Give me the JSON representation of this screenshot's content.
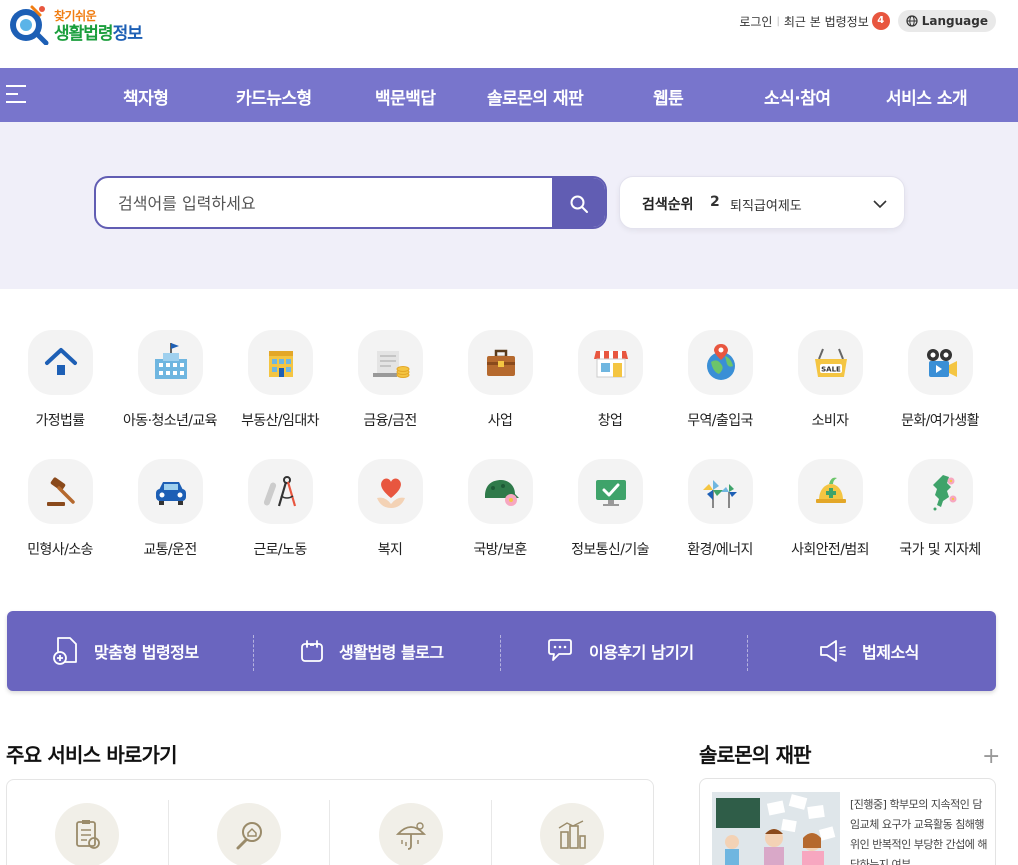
{
  "header": {
    "logo_small": "찾기쉬운",
    "logo_main_a": "생활법령",
    "logo_main_b": "정보",
    "login": "로그인",
    "recent": "최근 본 법령정보",
    "recent_count": "4",
    "language": "Language"
  },
  "nav": {
    "items": [
      "책자형",
      "카드뉴스형",
      "백문백답",
      "솔로몬의 재판",
      "웹툰",
      "소식·참여",
      "서비스 소개"
    ]
  },
  "search": {
    "placeholder": "검색어를 입력하세요",
    "rank_label": "검색순위",
    "rank_num": "2",
    "rank_term": "퇴직급여제도"
  },
  "categories": [
    {
      "label": "가정법률",
      "icon": "house-icon"
    },
    {
      "label": "아동·청소년/교육",
      "icon": "school-icon"
    },
    {
      "label": "부동산/임대차",
      "icon": "building-icon"
    },
    {
      "label": "금융/금전",
      "icon": "money-icon"
    },
    {
      "label": "사업",
      "icon": "briefcase-icon"
    },
    {
      "label": "창업",
      "icon": "store-icon"
    },
    {
      "label": "무역/출입국",
      "icon": "globe-icon"
    },
    {
      "label": "소비자",
      "icon": "sale-basket-icon"
    },
    {
      "label": "문화/여가생활",
      "icon": "camera-icon"
    },
    {
      "label": "민형사/소송",
      "icon": "gavel-icon"
    },
    {
      "label": "교통/운전",
      "icon": "car-icon"
    },
    {
      "label": "근로/노동",
      "icon": "compass-icon"
    },
    {
      "label": "복지",
      "icon": "heart-hand-icon"
    },
    {
      "label": "국방/보훈",
      "icon": "helmet-icon"
    },
    {
      "label": "정보통신/기술",
      "icon": "monitor-icon"
    },
    {
      "label": "환경/에너지",
      "icon": "pinwheel-icon"
    },
    {
      "label": "사회안전/범죄",
      "icon": "safety-helmet-icon"
    },
    {
      "label": "국가 및 지자체",
      "icon": "korea-map-icon"
    }
  ],
  "banner": {
    "items": [
      "맞춤형 법령정보",
      "생활법령 블로그",
      "이용후기 남기기",
      "법제소식"
    ]
  },
  "sections": {
    "main_services": "주요 서비스 바로가기",
    "solomon": "솔로몬의 재판",
    "plus": "+",
    "solomon_text": "[진행중] 학부모의 지속적인 담임교체 요구가 교육활동 침해행위인 반복적인 부당한 간섭에 해당하는지 여부"
  },
  "colors": {
    "nav": "#7875cc",
    "search_bg": "#f0eff9",
    "accent": "#615db3",
    "banner": "#6a65bf"
  }
}
